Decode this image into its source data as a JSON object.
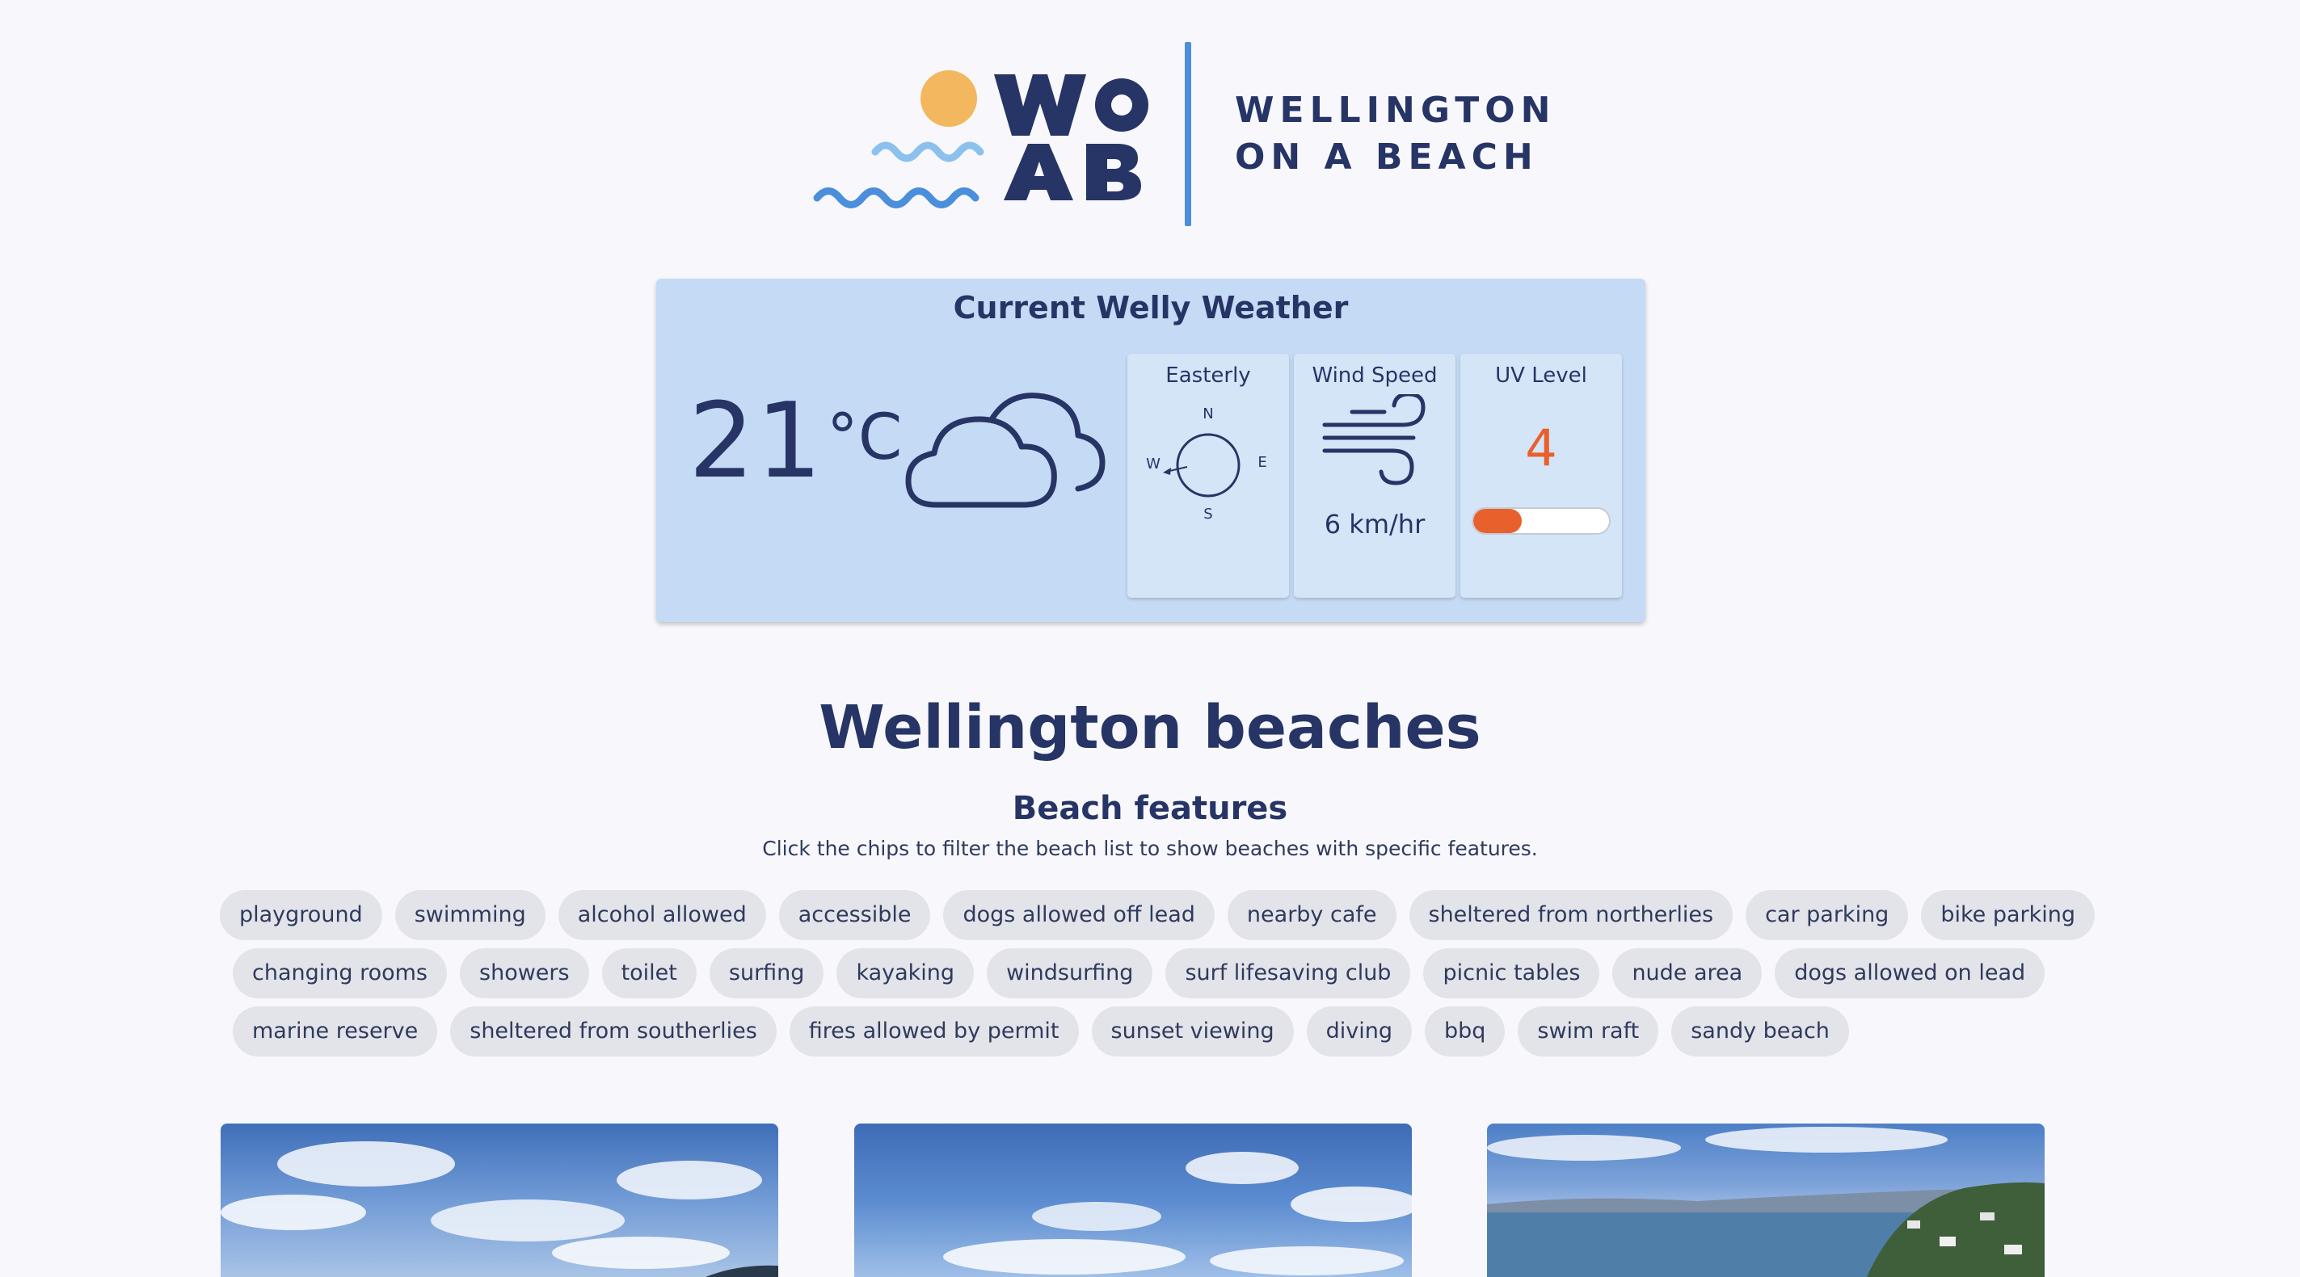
{
  "brand": {
    "logo_mark": "WOAB",
    "line1": "WELLINGTON",
    "line2": "ON A BEACH",
    "colors": {
      "navy": "#263565",
      "sun": "#f3b760",
      "wave_light": "#8cc1ee",
      "wave_dark": "#4a8edc"
    }
  },
  "weather": {
    "title": "Current Welly Weather",
    "temperature": "21",
    "unit": "°C",
    "condition_icon": "cloud-icon",
    "wind_direction": {
      "label": "Easterly",
      "n": "N",
      "e": "E",
      "s": "S",
      "w": "W"
    },
    "wind_speed": {
      "label": "Wind Speed",
      "value": "6 km/hr",
      "icon": "wind-icon"
    },
    "uv": {
      "label": "UV Level",
      "value": "4",
      "level_fraction": 0.36,
      "color": "#e8602c"
    }
  },
  "main": {
    "title": "Wellington beaches",
    "features_title": "Beach features",
    "features_hint": "Click the chips to filter the beach list to show beaches with specific features."
  },
  "chips": {
    "row1": [
      "playground",
      "swimming",
      "alcohol allowed",
      "accessible",
      "dogs allowed off lead",
      "nearby cafe",
      "sheltered from northerlies",
      "car parking",
      "bike parking"
    ],
    "row2": [
      "changing rooms",
      "showers",
      "toilet",
      "surfing",
      "kayaking",
      "windsurfing",
      "surf lifesaving club",
      "picnic tables",
      "nude area",
      "dogs allowed on lead"
    ],
    "row3": [
      "marine reserve",
      "sheltered from southerlies",
      "fires allowed by permit",
      "sunset viewing",
      "diving",
      "bbq",
      "swim raft",
      "sandy beach"
    ]
  }
}
